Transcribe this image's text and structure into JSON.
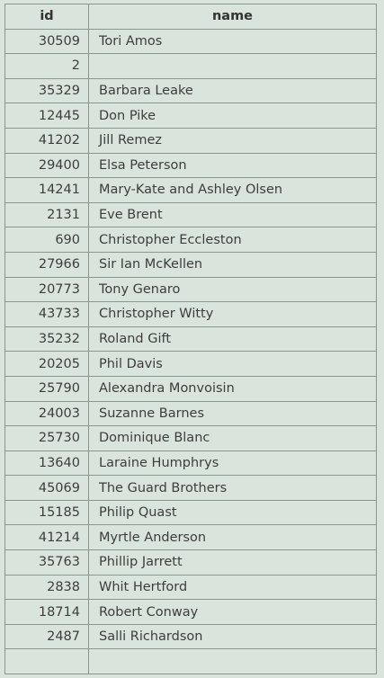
{
  "table": {
    "columns": [
      "id",
      "name"
    ],
    "rows": [
      {
        "id": "30509",
        "name": "Tori Amos"
      },
      {
        "id": "2",
        "name": ""
      },
      {
        "id": "35329",
        "name": "Barbara Leake"
      },
      {
        "id": "12445",
        "name": "Don Pike"
      },
      {
        "id": "41202",
        "name": "Jill Remez"
      },
      {
        "id": "29400",
        "name": "Elsa Peterson"
      },
      {
        "id": "14241",
        "name": "Mary-Kate and Ashley Olsen"
      },
      {
        "id": "2131",
        "name": "Eve Brent"
      },
      {
        "id": "690",
        "name": "Christopher Eccleston"
      },
      {
        "id": "27966",
        "name": "Sir Ian McKellen"
      },
      {
        "id": "20773",
        "name": "Tony Genaro"
      },
      {
        "id": "43733",
        "name": "Christopher Witty"
      },
      {
        "id": "35232",
        "name": "Roland Gift"
      },
      {
        "id": "20205",
        "name": "Phil Davis"
      },
      {
        "id": "25790",
        "name": "Alexandra Monvoisin"
      },
      {
        "id": "24003",
        "name": "Suzanne Barnes"
      },
      {
        "id": "25730",
        "name": "Dominique Blanc"
      },
      {
        "id": "13640",
        "name": "Laraine Humphrys"
      },
      {
        "id": "45069",
        "name": "The Guard Brothers"
      },
      {
        "id": "15185",
        "name": "Philip Quast"
      },
      {
        "id": "41214",
        "name": "Myrtle Anderson"
      },
      {
        "id": "35763",
        "name": "Phillip Jarrett"
      },
      {
        "id": "2838",
        "name": "Whit Hertford"
      },
      {
        "id": "18714",
        "name": "Robert Conway"
      },
      {
        "id": "2487",
        "name": "Salli Richardson"
      },
      {
        "id": "",
        "name": ""
      }
    ]
  },
  "colors": {
    "background": "#d9e5dc",
    "border": "#8a968e",
    "text": "#3d3d3d"
  }
}
